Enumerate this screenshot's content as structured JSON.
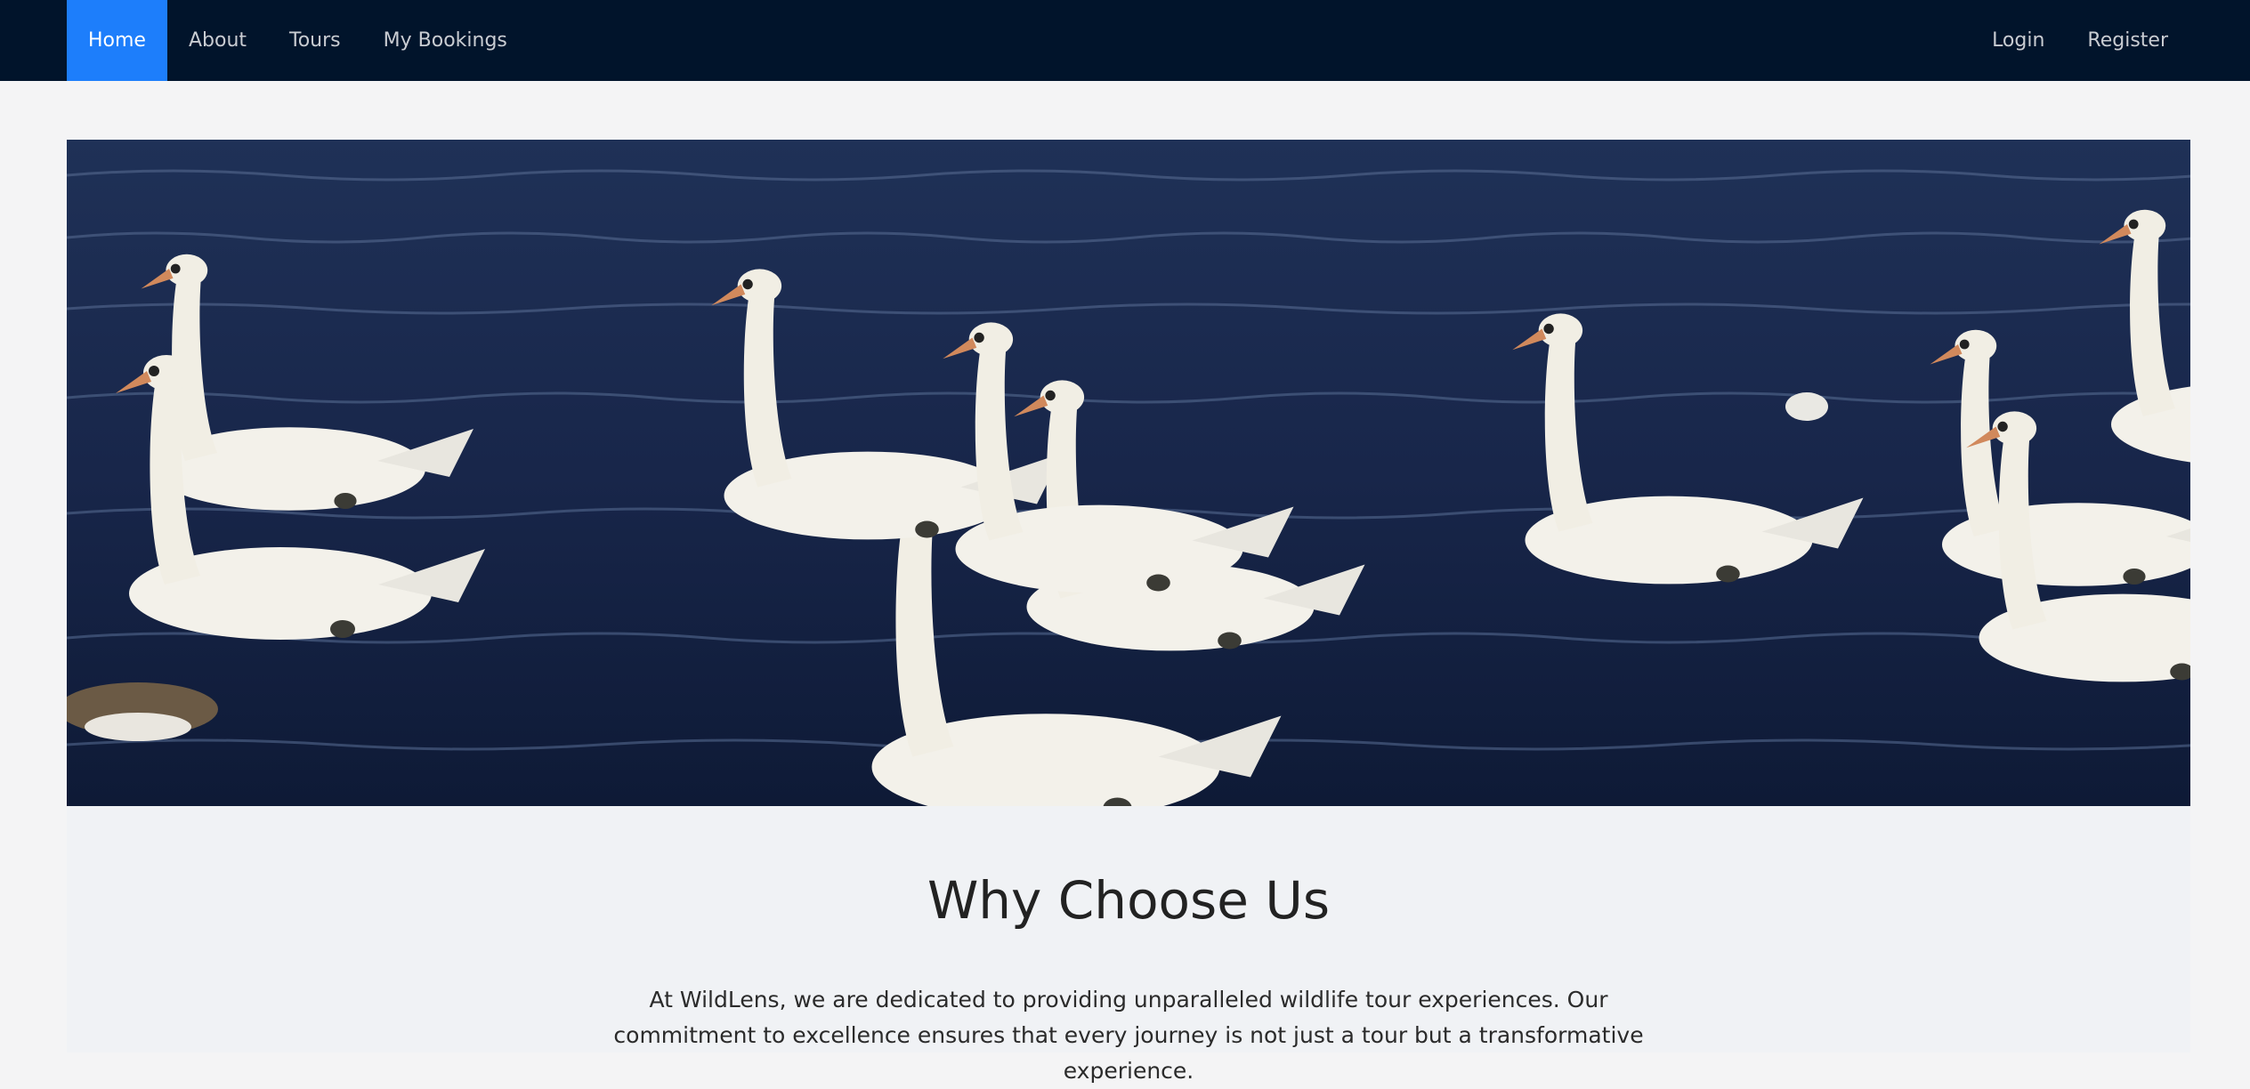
{
  "nav": {
    "left": [
      {
        "label": "Home",
        "active": true
      },
      {
        "label": "About",
        "active": false
      },
      {
        "label": "Tours",
        "active": false
      },
      {
        "label": "My Bookings",
        "active": false
      }
    ],
    "right": [
      {
        "label": "Login"
      },
      {
        "label": "Register"
      }
    ]
  },
  "hero": {
    "alt": "Swans swimming on dark blue water"
  },
  "about": {
    "title": "Why Choose Us",
    "text": "At WildLens, we are dedicated to providing unparalleled wildlife tour experiences. Our commitment to excellence ensures that every journey is not just a tour but a transformative experience."
  },
  "colors": {
    "navbar": "#01142b",
    "active": "#1d7efb",
    "page_bg": "#f4f4f5"
  }
}
